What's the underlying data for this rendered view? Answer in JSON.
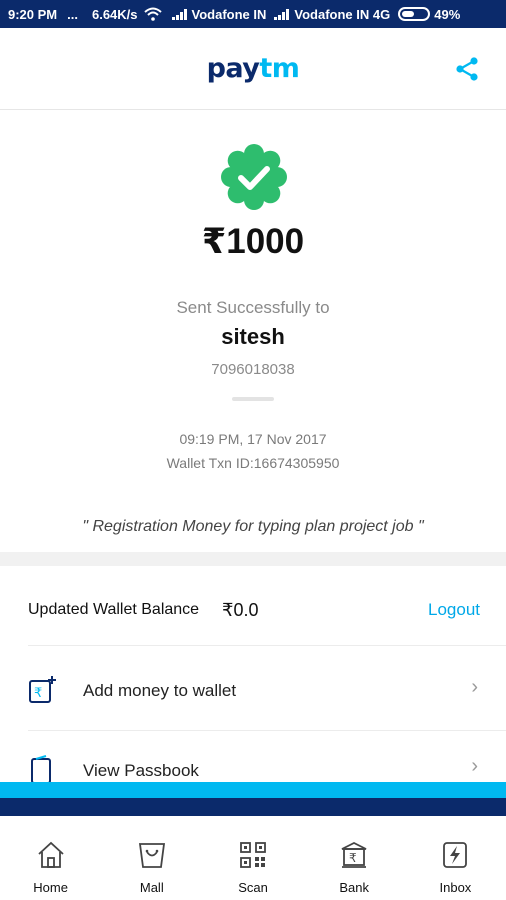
{
  "status_bar": {
    "time": "9:20 PM",
    "dots": "...",
    "speed": "6.64K/s",
    "carrier1": "Vodafone IN",
    "carrier2": "Vodafone IN 4G",
    "battery": "49%"
  },
  "header": {
    "logo_part1": "pay",
    "logo_part2": "tm"
  },
  "transaction": {
    "amount": "₹1000",
    "sent_label": "Sent Successfully to",
    "recipient": "sitesh",
    "phone": "7096018038",
    "datetime": "09:19 PM, 17 Nov 2017",
    "txn_id": "Wallet Txn ID:16674305950",
    "note": "\" Registration Money for typing plan project job \""
  },
  "wallet": {
    "label": "Updated Wallet Balance",
    "balance": "₹0.0",
    "logout": "Logout"
  },
  "list": [
    {
      "label": "Add money to wallet",
      "icon": "wallet-add-icon"
    },
    {
      "label": "View Passbook",
      "icon": "passbook-icon"
    }
  ],
  "tabs": [
    {
      "label": "Home",
      "icon": "home-icon"
    },
    {
      "label": "Mall",
      "icon": "mall-bag-icon"
    },
    {
      "label": "Scan",
      "icon": "qr-scan-icon"
    },
    {
      "label": "Bank",
      "icon": "bank-icon"
    },
    {
      "label": "Inbox",
      "icon": "inbox-bolt-icon"
    }
  ],
  "colors": {
    "brand_dark": "#0b2a6b",
    "brand_light": "#00b9f1",
    "success": "#2ebd6e",
    "link": "#00a8e8"
  }
}
